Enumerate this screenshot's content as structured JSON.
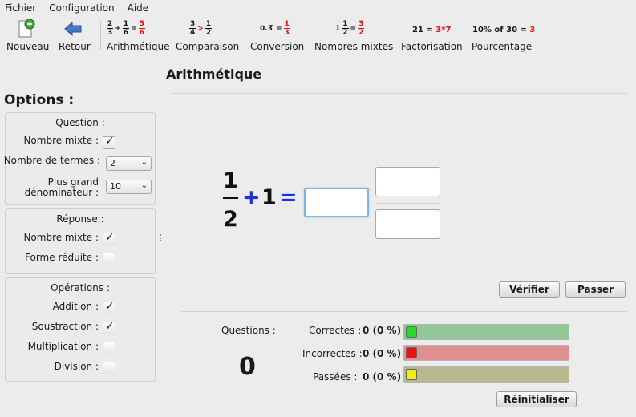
{
  "menubar": {
    "file": "Fichier",
    "config": "Configuration",
    "help": "Aide"
  },
  "toolbar": {
    "new_label": "Nouveau",
    "back_label": "Retour",
    "arith_label": "Arithmétique",
    "comp_label": "Comparaison",
    "conv_label": "Conversion",
    "mixed_label": "Nombres mixtes",
    "fact_label": "Factorisation",
    "pct_label": "Pourcentage",
    "arith_glyph": {
      "a_n": "2",
      "a_d": "3",
      "op": "+",
      "b_n": "1",
      "b_d": "6",
      "eq": "=",
      "r_n": "5",
      "r_d": "6"
    },
    "comp_glyph": {
      "a_n": "3",
      "a_d": "4",
      "op": ">",
      "b_n": "1",
      "b_d": "2"
    },
    "conv_glyph": {
      "dec": "0.3̅",
      "eq": "=",
      "r_n": "1",
      "r_d": "3"
    },
    "mixed_glyph": {
      "whole": "1",
      "a_n": "1",
      "a_d": "2",
      "eq": "=",
      "r_n": "3",
      "r_d": "2"
    },
    "fact_glyph": {
      "num": "21",
      "eq": "=",
      "res": "3*7"
    },
    "pct_glyph": {
      "expr": "10% of 30",
      "eq": "=",
      "res": "3"
    }
  },
  "main": {
    "title": "Arithmétique",
    "equation": {
      "num": "1",
      "den": "2",
      "op": "+",
      "whole": "1",
      "eq": "="
    },
    "answer_whole": "",
    "answer_num": "",
    "answer_den": "",
    "check_button": "Vérifier",
    "skip_button": "Passer"
  },
  "options": {
    "title": "Options :",
    "question": {
      "title": "Question :",
      "mixed_label": "Nombre mixte :",
      "terms_label": "Nombre de termes :",
      "terms_value": "2",
      "denom_label_1": "Plus grand",
      "denom_label_2": "dénominateur :",
      "denom_value": "10"
    },
    "answer": {
      "title": "Réponse :",
      "mixed_label": "Nombre mixte :",
      "reduced_label": "Forme réduite :"
    },
    "operations": {
      "title": "Opérations :",
      "addition": "Addition :",
      "subtraction": "Soustraction :",
      "multiplication": "Multiplication :",
      "division": "Division :"
    }
  },
  "stats": {
    "questions_label": "Questions :",
    "questions_count": "0",
    "correct_label": "Correctes :",
    "correct_value": "0 (0 %)",
    "incorrect_label": "Incorrectes :",
    "incorrect_value": "0 (0 %)",
    "skipped_label": "Passées :",
    "skipped_value": "0 (0 %)",
    "reset_button": "Réinitialiser",
    "colors": {
      "correct": "#93c795",
      "incorrect": "#e09090",
      "skipped": "#b8b88f",
      "correct_led": "#22dd22",
      "incorrect_led": "#ee1111",
      "skipped_led": "#eeee11"
    }
  }
}
